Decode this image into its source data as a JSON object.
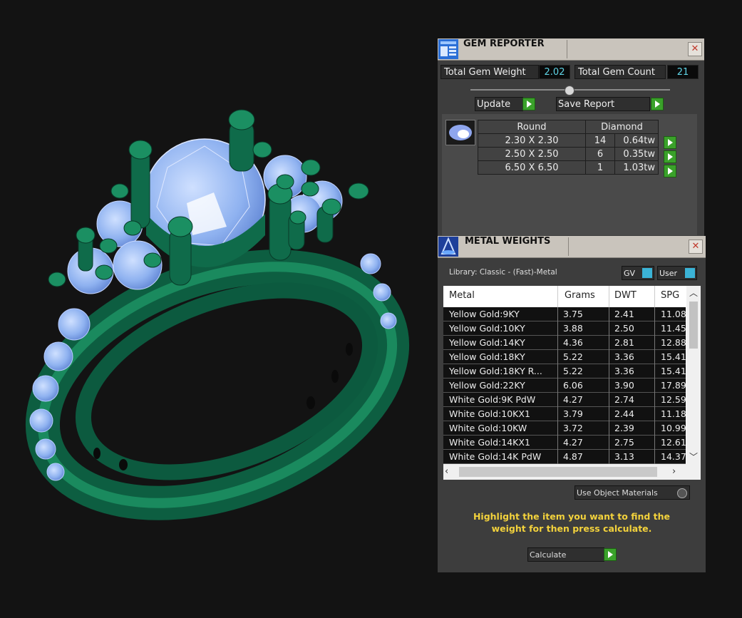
{
  "gem_reporter": {
    "title": "GEM REPORTER",
    "total_weight_label": "Total Gem Weight",
    "total_weight_value": "2.02",
    "total_count_label": "Total Gem Count",
    "total_count_value": "21",
    "update_label": "Update",
    "save_label": "Save Report",
    "table": {
      "shape": "Round",
      "material": "Diamond",
      "rows": [
        {
          "size": "2.30 X 2.30",
          "count": "14",
          "weight": "0.64tw"
        },
        {
          "size": "2.50 X 2.50",
          "count": "6",
          "weight": "0.35tw"
        },
        {
          "size": "6.50 X 6.50",
          "count": "1",
          "weight": "1.03tw"
        }
      ]
    }
  },
  "metal_weights": {
    "title": "METAL WEIGHTS",
    "library": "Library: Classic - (Fast)-Metal",
    "gv_label": "GV",
    "user_label": "User",
    "columns": [
      "Metal",
      "Grams",
      "DWT",
      "SPG"
    ],
    "rows": [
      {
        "metal": "Yellow Gold:9KY",
        "grams": "3.75",
        "dwt": "2.41",
        "spg": "11.08"
      },
      {
        "metal": "Yellow Gold:10KY",
        "grams": "3.88",
        "dwt": "2.50",
        "spg": "11.45"
      },
      {
        "metal": "Yellow Gold:14KY",
        "grams": "4.36",
        "dwt": "2.81",
        "spg": "12.88"
      },
      {
        "metal": "Yellow Gold:18KY",
        "grams": "5.22",
        "dwt": "3.36",
        "spg": "15.41"
      },
      {
        "metal": "Yellow Gold:18KY R...",
        "grams": "5.22",
        "dwt": "3.36",
        "spg": "15.41"
      },
      {
        "metal": "Yellow Gold:22KY",
        "grams": "6.06",
        "dwt": "3.90",
        "spg": "17.89"
      },
      {
        "metal": "White Gold:9K PdW",
        "grams": "4.27",
        "dwt": "2.74",
        "spg": "12.59"
      },
      {
        "metal": "White Gold:10KX1",
        "grams": "3.79",
        "dwt": "2.44",
        "spg": "11.18"
      },
      {
        "metal": "White Gold:10KW",
        "grams": "3.72",
        "dwt": "2.39",
        "spg": "10.99"
      },
      {
        "metal": "White Gold:14KX1",
        "grams": "4.27",
        "dwt": "2.75",
        "spg": "12.61"
      },
      {
        "metal": "White Gold:14K PdW",
        "grams": "4.87",
        "dwt": "3.13",
        "spg": "14.37"
      }
    ],
    "use_object_materials": "Use Object Materials",
    "instruction": "Highlight the item you want to find the weight for then press calculate.",
    "calculate_label": "Calculate"
  },
  "colors": {
    "metal_green": "#0f6b4a",
    "gem_blue": "#8fb4f2",
    "accent_button": "#3aa12a",
    "instruction_yellow": "#f3d23c"
  }
}
